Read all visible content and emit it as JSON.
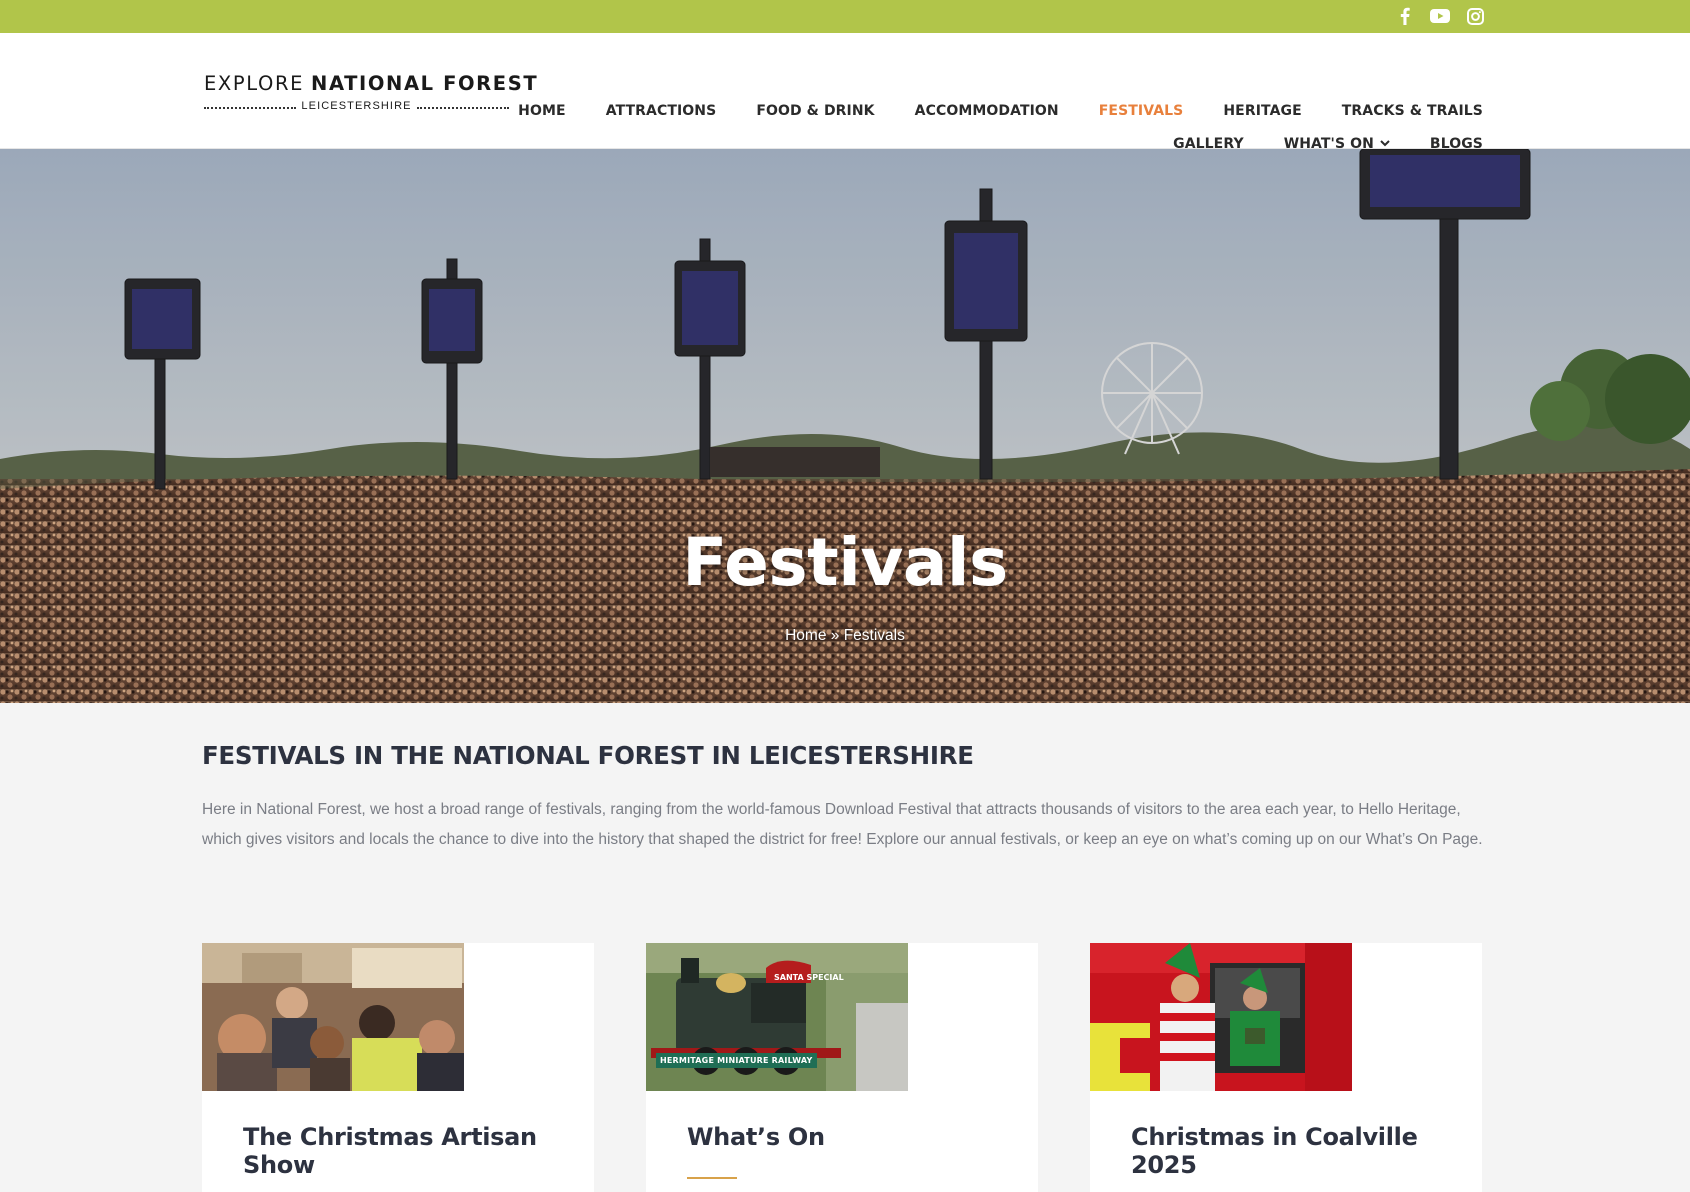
{
  "social": {
    "icons": [
      "facebook-icon",
      "youtube-icon",
      "instagram-icon"
    ]
  },
  "logo": {
    "part1": "EXPLORE",
    "part2": "NATIONAL FOREST",
    "sub": "LEICESTERSHIRE"
  },
  "nav": {
    "row1": [
      "HOME",
      "ATTRACTIONS",
      "FOOD & DRINK",
      "ACCOMMODATION",
      "FESTIVALS",
      "HERITAGE",
      "TRACKS & TRAILS"
    ],
    "row2": [
      "GALLERY",
      "WHAT'S ON",
      "BLOGS"
    ],
    "active": "FESTIVALS",
    "active_color": "#e8803c"
  },
  "hero": {
    "title": "Festivals",
    "breadcrumb_home": "Home",
    "breadcrumb_sep": "»",
    "breadcrumb_current": "Festivals"
  },
  "main": {
    "heading": "FESTIVALS IN THE NATIONAL FOREST IN LEICESTERSHIRE",
    "intro": "Here in National Forest, we host a broad range of festivals, ranging from the world-famous Download Festival that attracts thousands of visitors to the area each year, to Hello Heritage, which gives visitors and locals the chance to dive into the history that shaped the district for free! Explore our annual festivals, or keep an eye on what’s coming up on our What’s On Page."
  },
  "cards": [
    {
      "title": "The Christmas Artisan Show"
    },
    {
      "title": "What’s On",
      "image_caption": "HERMITAGE MINIATURE RAILWAY",
      "sign_text": "SANTA SPECIAL"
    },
    {
      "title": "Christmas in Coalville 2025"
    }
  ],
  "colors": {
    "topbar": "#b1c54a",
    "accent": "#e8803c",
    "heading": "#2d3240",
    "body_text": "#7a7d85",
    "rule": "#d8a24a"
  }
}
